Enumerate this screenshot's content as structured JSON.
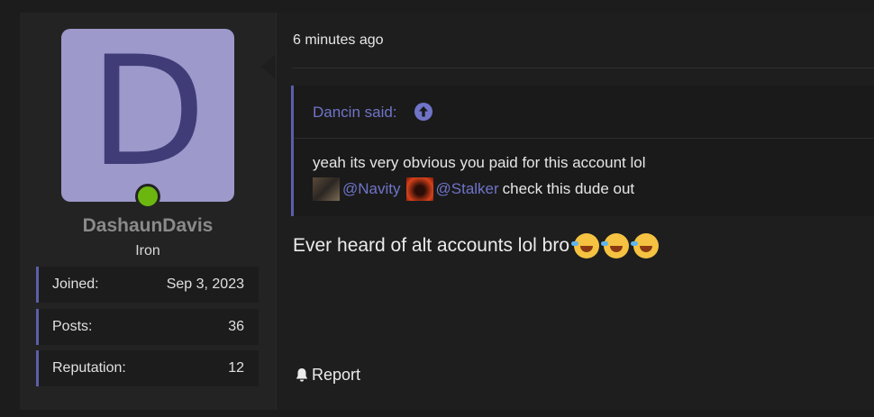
{
  "user": {
    "avatar_letter": "D",
    "username": "DashaunDavis",
    "rank": "Iron",
    "stats": [
      {
        "label": "Joined:",
        "value": "Sep 3, 2023"
      },
      {
        "label": "Posts:",
        "value": "36"
      },
      {
        "label": "Reputation:",
        "value": "12"
      }
    ]
  },
  "post": {
    "time": "6 minutes ago",
    "quote": {
      "author": "Dancin said:",
      "line1": "yeah its very obvious you paid for this account lol",
      "mention1": "@Navity",
      "mention2": "@Stalker",
      "line2_tail": "check this dude out"
    },
    "message": "Ever heard of alt accounts lol bro",
    "emojis": [
      "rofl-emoji",
      "rofl-emoji",
      "rofl-emoji"
    ],
    "report_label": "Report"
  },
  "colors": {
    "accent": "#6f74c8",
    "online": "#6bb70f",
    "avatar_bg": "#9d99cb"
  }
}
